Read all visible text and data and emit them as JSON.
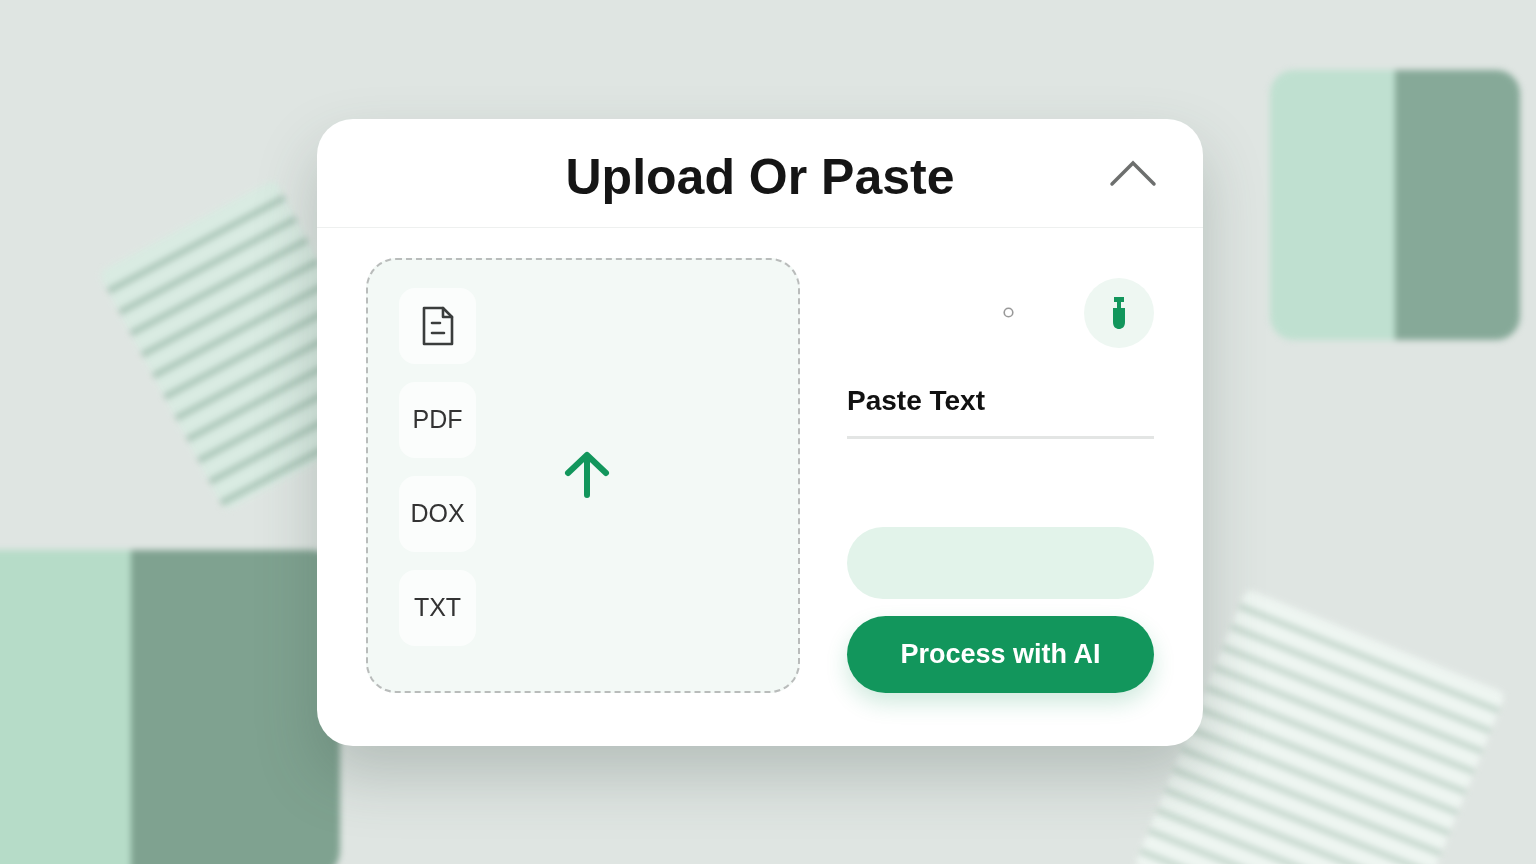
{
  "dialog": {
    "title": "Upload Or Paste",
    "expanded": true
  },
  "file_types": [
    {
      "kind": "icon"
    },
    {
      "kind": "label",
      "label": "PDF"
    },
    {
      "kind": "label",
      "label": "DOX"
    },
    {
      "kind": "label",
      "label": "TXT"
    }
  ],
  "paste": {
    "label": "Paste Text"
  },
  "primary_button": {
    "label": "Process with AI"
  }
}
